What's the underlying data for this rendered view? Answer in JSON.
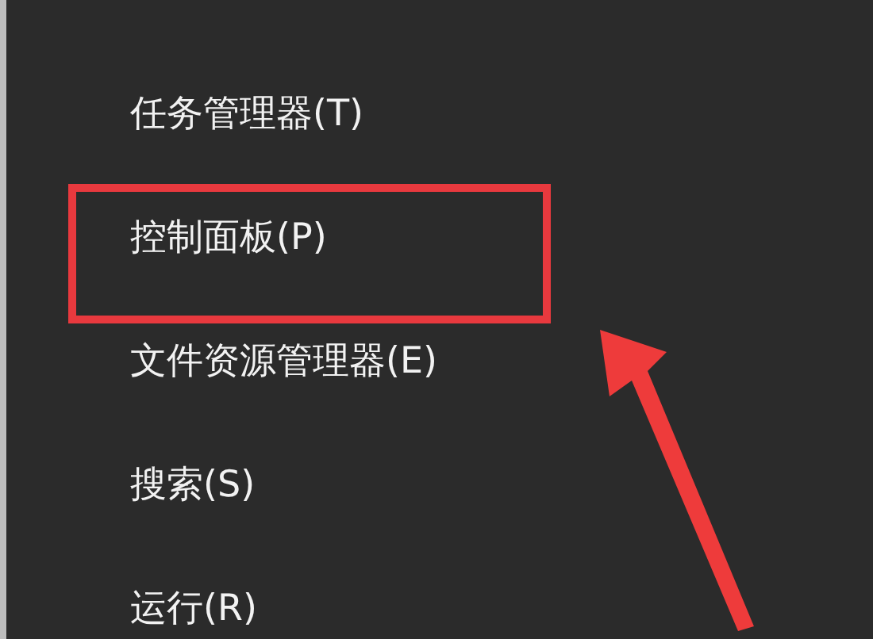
{
  "menu": {
    "items": [
      {
        "label": "任务管理器(T)",
        "highlighted": false
      },
      {
        "label": "控制面板(P)",
        "highlighted": true
      },
      {
        "label": "文件资源管理器(E)",
        "highlighted": false
      },
      {
        "label": "搜索(S)",
        "highlighted": false
      },
      {
        "label": "运行(R)",
        "highlighted": false
      }
    ]
  }
}
